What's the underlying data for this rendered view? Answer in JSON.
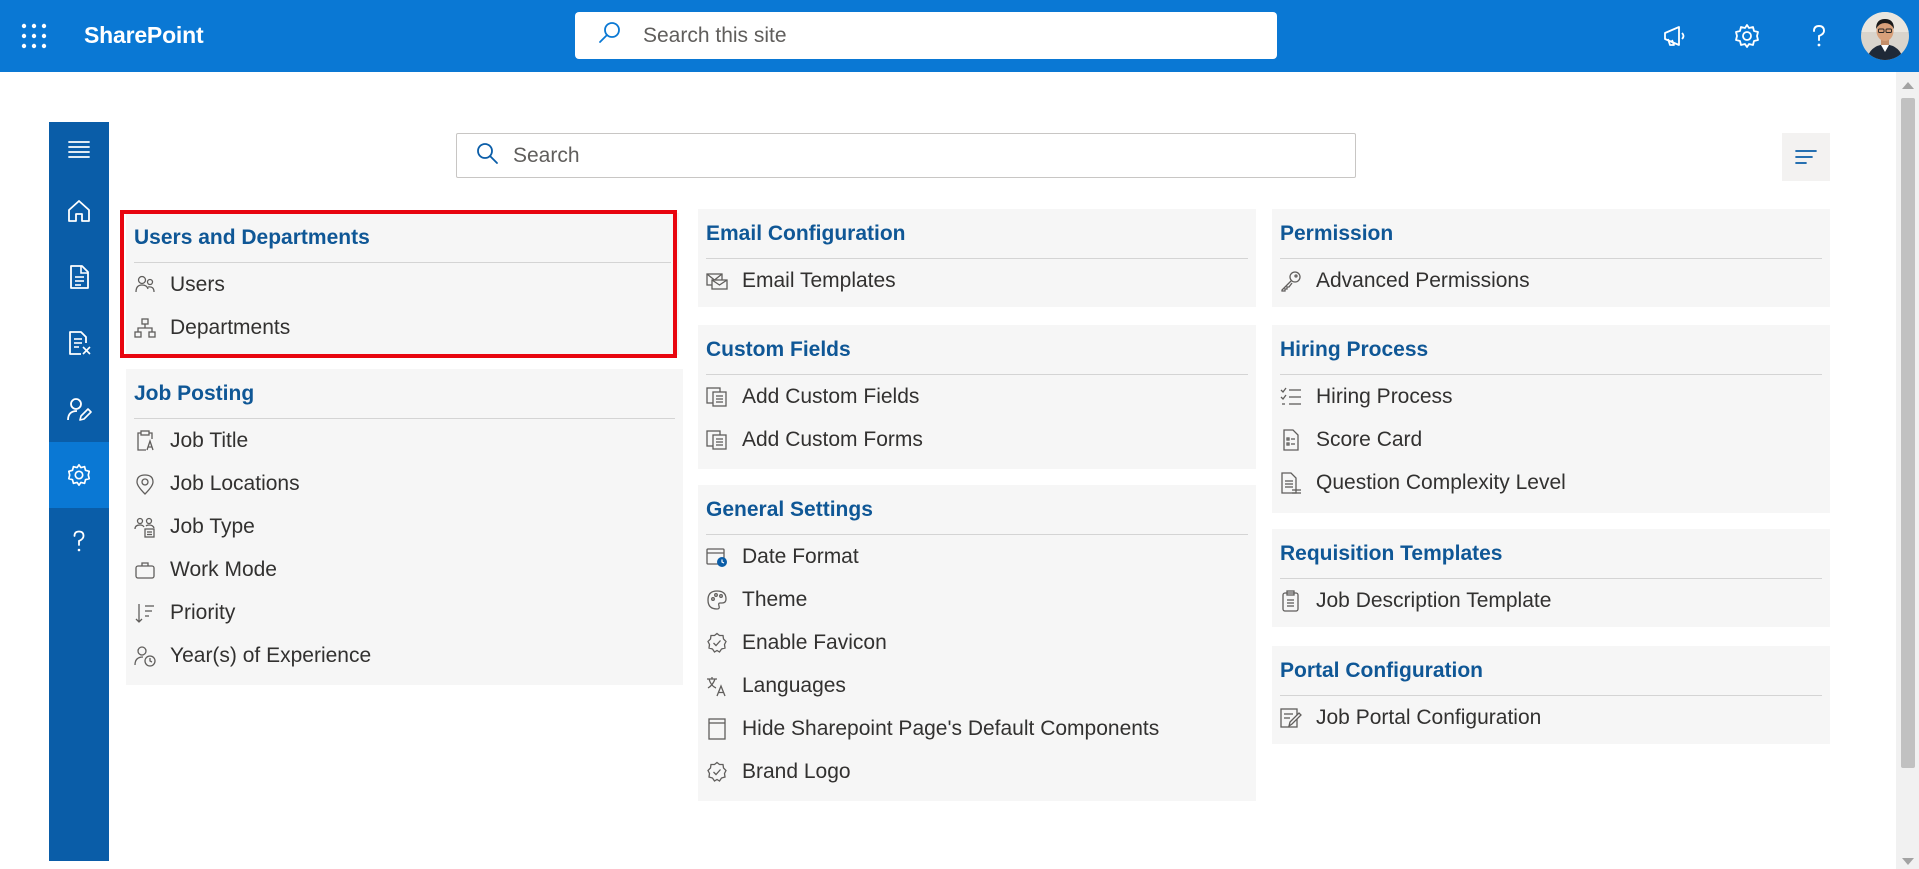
{
  "suitebar": {
    "brand": "SharePoint",
    "search_placeholder": "Search this site",
    "icons": [
      "waffle-icon",
      "megaphone-icon",
      "gear-icon",
      "help-icon",
      "avatar"
    ]
  },
  "rail": {
    "items": [
      "menu-icon",
      "home-icon",
      "document-icon",
      "document-x-icon",
      "person-edit-icon",
      "gear-icon",
      "help-icon"
    ],
    "active": "gear-icon"
  },
  "main": {
    "search_placeholder": "Search",
    "columns": [
      {
        "cards": [
          {
            "title": "Users and Departments",
            "highlighted": true,
            "items": [
              {
                "label": "Users",
                "icon": "people-icon"
              },
              {
                "label": "Departments",
                "icon": "org-chart-icon"
              }
            ]
          },
          {
            "title": "Job Posting",
            "items": [
              {
                "label": "Job Title",
                "icon": "clipboard-text-icon"
              },
              {
                "label": "Job Locations",
                "icon": "location-pin-icon"
              },
              {
                "label": "Job Type",
                "icon": "people-settings-icon"
              },
              {
                "label": "Work Mode",
                "icon": "briefcase-icon"
              },
              {
                "label": "Priority",
                "icon": "sort-descending-icon"
              },
              {
                "label": "Year(s) of Experience",
                "icon": "person-clock-icon"
              }
            ]
          }
        ]
      },
      {
        "cards": [
          {
            "title": "Email Configuration",
            "items": [
              {
                "label": "Email Templates",
                "icon": "mail-template-icon"
              }
            ]
          },
          {
            "title": "Custom Fields",
            "items": [
              {
                "label": "Add Custom Fields",
                "icon": "form-copy-icon"
              },
              {
                "label": "Add Custom Forms",
                "icon": "form-copy-icon"
              }
            ]
          },
          {
            "title": "General Settings",
            "items": [
              {
                "label": "Date Format",
                "icon": "calendar-clock-icon"
              },
              {
                "label": "Theme",
                "icon": "palette-icon"
              },
              {
                "label": "Enable Favicon",
                "icon": "badge-check-icon"
              },
              {
                "label": "Languages",
                "icon": "translate-icon"
              },
              {
                "label": "Hide Sharepoint Page's Default Components",
                "icon": "page-icon"
              },
              {
                "label": "Brand Logo",
                "icon": "badge-check-icon"
              }
            ]
          }
        ]
      },
      {
        "cards": [
          {
            "title": "Permission",
            "items": [
              {
                "label": "Advanced Permissions",
                "icon": "key-icon"
              }
            ]
          },
          {
            "title": "Hiring Process",
            "items": [
              {
                "label": "Hiring Process",
                "icon": "checklist-icon"
              },
              {
                "label": "Score Card",
                "icon": "document-list-icon"
              },
              {
                "label": "Question Complexity Level",
                "icon": "document-lines-icon"
              }
            ]
          },
          {
            "title": "Requisition Templates",
            "items": [
              {
                "label": "Job Description Template",
                "icon": "clipboard-icon"
              }
            ]
          },
          {
            "title": "Portal Configuration",
            "items": [
              {
                "label": "Job Portal Configuration",
                "icon": "form-edit-icon"
              }
            ]
          }
        ]
      }
    ]
  },
  "colors": {
    "suitebar": "#0a78d4",
    "rail": "#0a5da8",
    "rail_active": "#0a78d4",
    "card_title": "#0f5796",
    "highlight": "#e8050f"
  }
}
